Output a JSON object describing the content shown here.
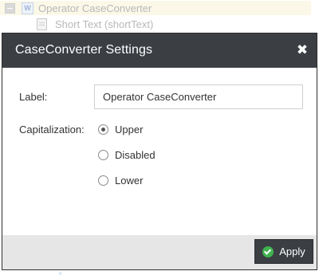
{
  "background_tree": {
    "items": [
      {
        "label": "Operator CaseConverter",
        "icon": "word-icon"
      },
      {
        "label": "Short Text (shortText)",
        "icon": "document-icon"
      }
    ]
  },
  "modal": {
    "title": "CaseConverter Settings",
    "close_icon": "close-icon",
    "label_field": {
      "label": "Label:",
      "value": "Operator CaseConverter",
      "placeholder": ""
    },
    "capitalization": {
      "label": "Capitalization:",
      "selected": "Upper",
      "options": [
        {
          "label": "Upper",
          "checked": true
        },
        {
          "label": "Disabled",
          "checked": false
        },
        {
          "label": "Lower",
          "checked": false
        }
      ]
    },
    "footer": {
      "apply_label": "Apply",
      "apply_icon": "check-circle-icon"
    }
  },
  "colors": {
    "header_bg": "#3b3f44",
    "footer_bg": "#e6e6e6",
    "apply_check": "#3fb34f"
  }
}
